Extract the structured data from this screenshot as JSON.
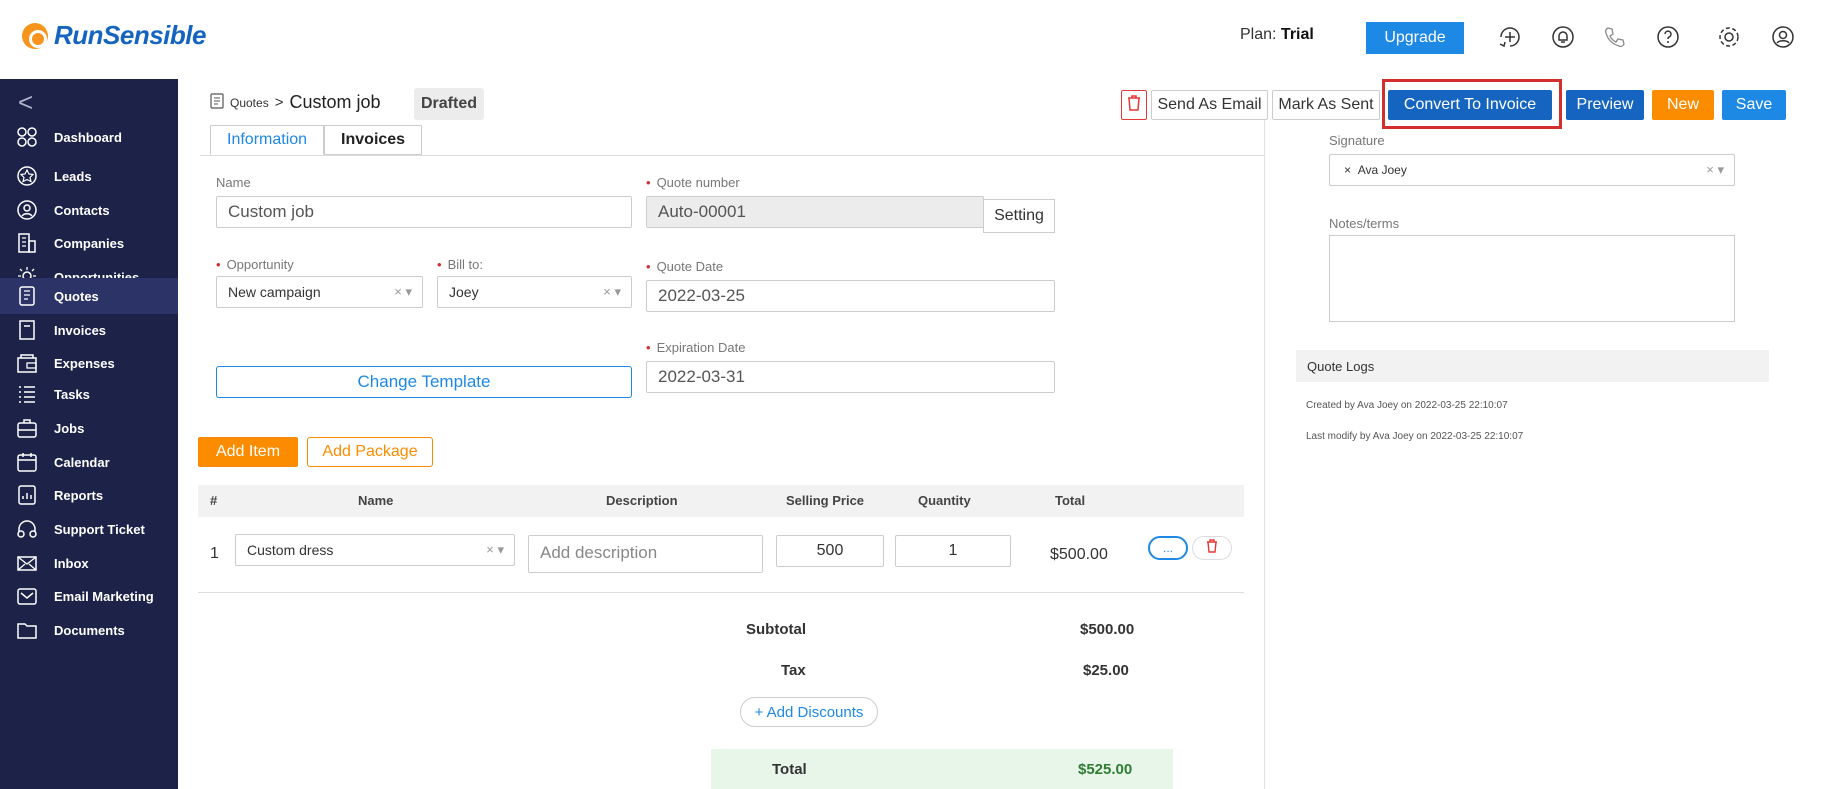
{
  "brand": {
    "name": "RunSensible"
  },
  "header": {
    "plan_label": "Plan:",
    "plan_value": "Trial",
    "upgrade_label": "Upgrade",
    "icons": [
      "add-entry-icon",
      "notification-bell-icon",
      "phone-icon",
      "help-icon",
      "settings-gear-icon",
      "user-account-icon"
    ]
  },
  "sidebar": {
    "collapse_glyph": "<",
    "items": [
      {
        "label": "Dashboard",
        "icon": "dashboard-icon"
      },
      {
        "label": "Leads",
        "icon": "leads-icon"
      },
      {
        "label": "Contacts",
        "icon": "contacts-icon"
      },
      {
        "label": "Companies",
        "icon": "companies-icon"
      },
      {
        "label": "Opportunities",
        "icon": "opportunities-icon"
      },
      {
        "label": "Quotes",
        "icon": "quotes-icon",
        "active": true
      },
      {
        "label": "Invoices",
        "icon": "invoices-icon"
      },
      {
        "label": "Expenses",
        "icon": "expenses-icon"
      },
      {
        "label": "Tasks",
        "icon": "tasks-icon"
      },
      {
        "label": "Jobs",
        "icon": "jobs-icon"
      },
      {
        "label": "Calendar",
        "icon": "calendar-icon"
      },
      {
        "label": "Reports",
        "icon": "reports-icon"
      },
      {
        "label": "Support Ticket",
        "icon": "support-icon"
      },
      {
        "label": "Inbox",
        "icon": "inbox-icon"
      },
      {
        "label": "Email Marketing",
        "icon": "email-marketing-icon"
      },
      {
        "label": "Documents",
        "icon": "documents-icon"
      }
    ]
  },
  "breadcrumb": {
    "parent": "Quotes",
    "separator": ">",
    "current": "Custom job"
  },
  "status": "Drafted",
  "actions": {
    "send_email": "Send As Email",
    "mark_sent": "Mark As Sent",
    "convert": "Convert To Invoice",
    "preview": "Preview",
    "new": "New",
    "save": "Save"
  },
  "tabs": [
    {
      "label": "Information",
      "active": true
    },
    {
      "label": "Invoices",
      "active": false
    }
  ],
  "form": {
    "name_label": "Name",
    "name_value": "Custom job",
    "quote_number_label": "Quote number",
    "quote_number_value": "Auto-00001",
    "setting_label": "Setting",
    "opportunity_label": "Opportunity",
    "opportunity_value": "New campaign",
    "bill_to_label": "Bill to:",
    "bill_to_value": "Joey",
    "quote_date_label": "Quote Date",
    "quote_date_value": "2022-03-25",
    "expiration_label": "Expiration Date",
    "expiration_value": "2022-03-31",
    "change_template": "Change Template"
  },
  "items": {
    "add_item": "Add Item",
    "add_package": "Add Package",
    "columns": [
      "#",
      "Name",
      "Description",
      "Selling Price",
      "Quantity",
      "Total"
    ],
    "rows": [
      {
        "num": "1",
        "name": "Custom dress",
        "description_placeholder": "Add description",
        "price": "500",
        "quantity": "1",
        "total": "$500.00"
      }
    ],
    "more_glyph": "...",
    "clear_glyph": "×"
  },
  "summary": {
    "subtotal_label": "Subtotal",
    "subtotal_value": "$500.00",
    "tax_label": "Tax",
    "tax_value": "$25.00",
    "add_discounts": "+ Add Discounts",
    "total_label": "Total",
    "total_value": "$525.00"
  },
  "right_panel": {
    "signature_label": "Signature",
    "signature_value": "Ava Joey",
    "notes_label": "Notes/terms",
    "logs_title": "Quote Logs",
    "logs": [
      "Created by Ava Joey on 2022-03-25 22:10:07",
      "Last modify by Ava Joey on 2022-03-25 22:10:07"
    ]
  },
  "colors": {
    "sidebar_bg": "#1c2248",
    "primary": "#1565c0",
    "accent_orange": "#fb8c00",
    "danger": "#e53935",
    "total_green": "#2e7d32"
  }
}
